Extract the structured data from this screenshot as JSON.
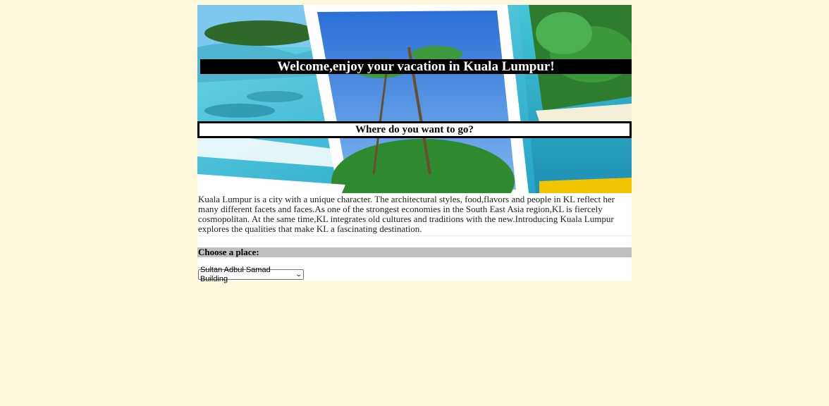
{
  "banner": {
    "welcome_text": "Welcome,enjoy your vacation in Kuala Lumpur!",
    "question_text": "Where do you want to go?"
  },
  "intro": {
    "paragraph": "Kuala Lumpur is a city with a unique character. The architectural styles, food,flavors and people in KL reflect her many different facets and faces.As one of the strongest economies in the South East Asia region,KL is fiercely cosmopolitan. At the same time,KL integrates old cultures and traditions with the new.Introducing Kuala Lumpur explores the qualities that make KL a fascinating destination."
  },
  "chooser": {
    "label": "Choose a place:",
    "selected": "Sultan Adbul Samad Building",
    "dropdown_icon": "chevron-down-icon"
  },
  "colors": {
    "page_background": "#fff8dc",
    "banner_title_bg": "#000000",
    "choose_bar_bg": "#bfbfbf"
  }
}
